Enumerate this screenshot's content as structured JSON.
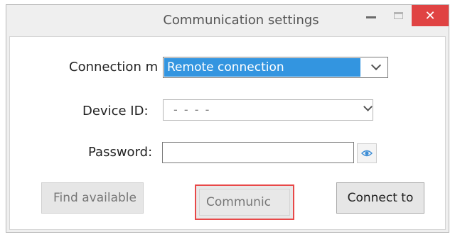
{
  "window": {
    "title": "Communication settings",
    "minimize_label": "–",
    "close_label": "✕"
  },
  "form": {
    "connection_mode": {
      "label": "Connection m",
      "selected_value": "Remote connection"
    },
    "device_id": {
      "label": "Device ID:",
      "value": "- - - -"
    },
    "password": {
      "label": "Password:",
      "value": ""
    }
  },
  "buttons": {
    "find_available": "Find available",
    "communicate": "Communic",
    "connect_to": "Connect to"
  },
  "colors": {
    "selection": "#3395e0",
    "close_button": "#e04343",
    "highlight_border": "#e84848"
  },
  "icons": {
    "close": "close-icon",
    "minimize": "minimize-icon",
    "maximize": "maximize-icon",
    "dropdown": "chevron-down-icon",
    "show_password": "eye-icon"
  }
}
